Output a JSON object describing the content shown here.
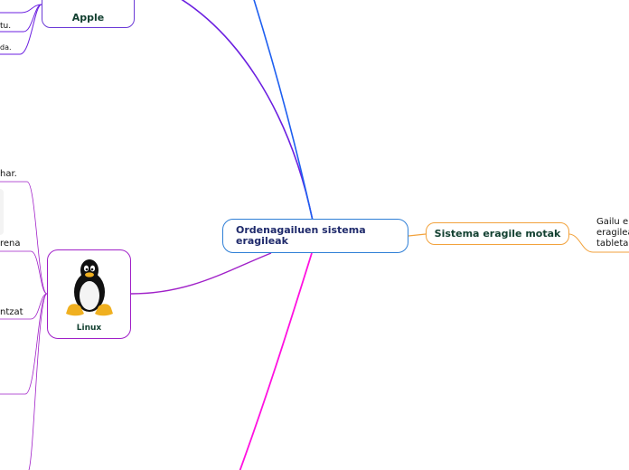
{
  "central": {
    "title": "Ordenagailuen sistema eragileak"
  },
  "types": {
    "title": "Sistema eragile motak"
  },
  "types_child": {
    "lines": [
      "Gailu er",
      "eragilea",
      "tableta"
    ]
  },
  "apple": {
    "label": "Apple"
  },
  "linux": {
    "label": "Linux"
  },
  "apple_children": [
    "tu.",
    "da."
  ],
  "linux_children": [
    "har.",
    "rena",
    "ntzat"
  ],
  "colors": {
    "central_border": "#2f7fd6",
    "types_border": "#f2a23c",
    "apple_branch": "#6b1fe0",
    "linux_branch": "#a020c8",
    "blue_branch": "#1e5ff0",
    "magenta_branch": "#ff10e0"
  },
  "icons": [
    "apple-logo-icon",
    "tux-penguin-icon"
  ]
}
